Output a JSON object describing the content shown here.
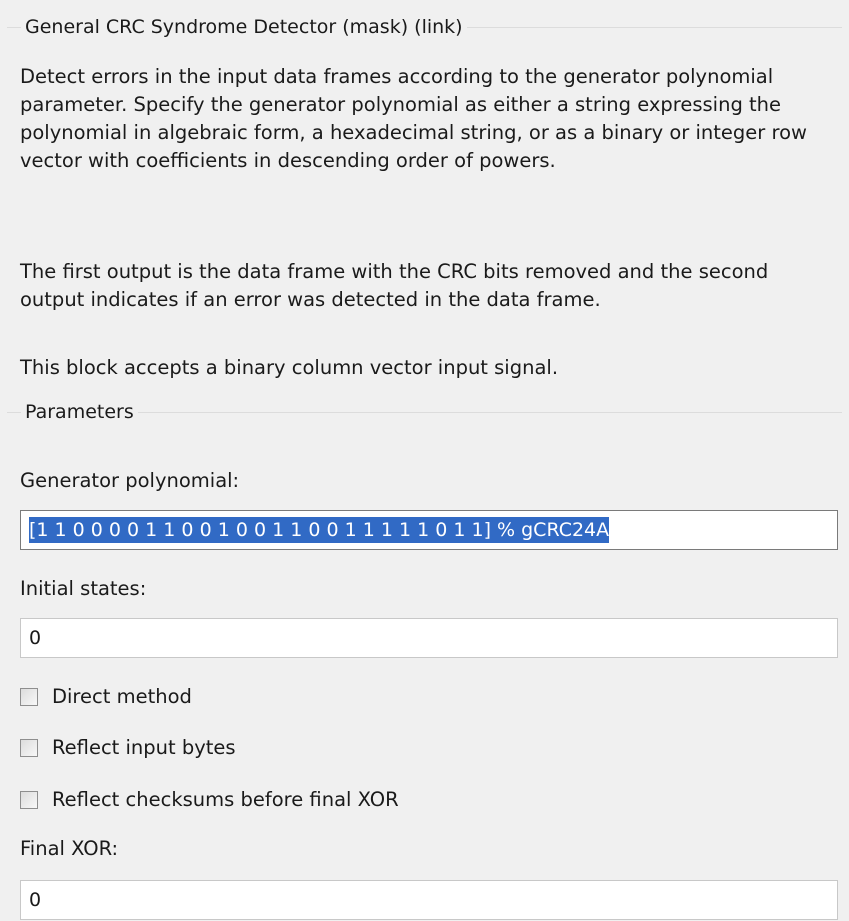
{
  "block": {
    "title": "General CRC Syndrome Detector (mask) (link)",
    "description_paragraphs": [
      "Detect errors in the input data frames according to the generator polynomial parameter. Specify the generator polynomial as either a string expressing the polynomial in algebraic form, a hexadecimal string, or as a binary or integer row vector with coefficients in descending order of powers.",
      "The first output is the data frame with the CRC bits removed and the second output indicates if an error was detected in the data frame.",
      "This block accepts a binary column vector input signal."
    ]
  },
  "parameters": {
    "title": "Parameters",
    "generator_polynomial": {
      "label": "Generator polynomial:",
      "value": "[1 1 0 0 0 0 1 1 0 0 1 0 0 1 1 0 0  1 1 1 1 1 0 1 1] % gCRC24A"
    },
    "initial_states": {
      "label": "Initial states:",
      "value": "0"
    },
    "direct_method": {
      "label": "Direct method",
      "checked": false
    },
    "reflect_input_bytes": {
      "label": "Reflect input bytes",
      "checked": false
    },
    "reflect_checksums": {
      "label": "Reflect checksums before final XOR",
      "checked": false
    },
    "final_xor": {
      "label": "Final XOR:",
      "value": "0"
    }
  },
  "colors": {
    "background": "#f0f0f0",
    "selection": "#316ac5",
    "field_background": "#ffffff",
    "group_border": "#dcdcdc"
  }
}
